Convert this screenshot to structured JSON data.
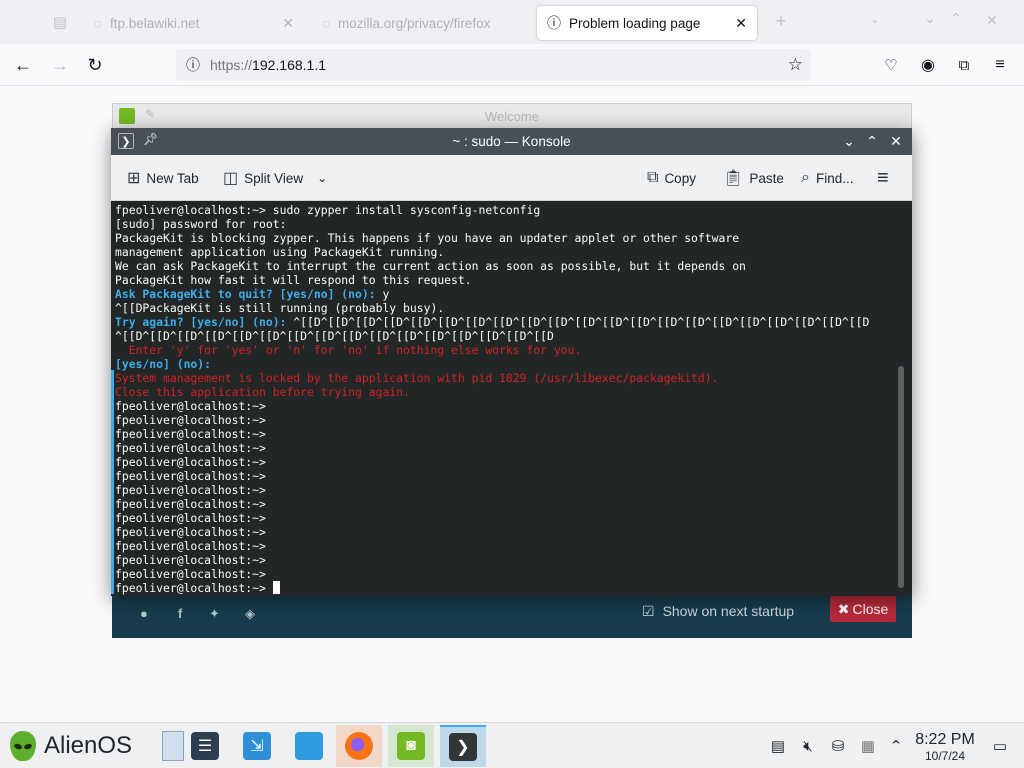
{
  "browser": {
    "tabs": [
      {
        "label": "ftp.belawiki.net"
      },
      {
        "label": "mozilla.org/privacy/firefox"
      },
      {
        "label": "Problem loading page"
      }
    ],
    "new_tab_symbol": "+",
    "url_proto": "https://",
    "url_host": "192.168.1.1"
  },
  "welcome": {
    "title": "Welcome",
    "show_startup_label": "Show on next startup",
    "close_label": "Close"
  },
  "konsole": {
    "title": "~ : sudo — Konsole",
    "toolbar": {
      "new_tab": "New Tab",
      "split_view": "Split View",
      "copy": "Copy",
      "paste": "Paste",
      "find": "Find..."
    },
    "lines": [
      {
        "text": "fpeoliver@localhost:~> sudo zypper install sysconfig-netconfig",
        "style": ""
      },
      {
        "text": "[sudo] password for root:",
        "style": ""
      },
      {
        "text": "PackageKit is blocking zypper. This happens if you have an updater applet or other software",
        "style": ""
      },
      {
        "text": "management application using PackageKit running.",
        "style": ""
      },
      {
        "text": "We can ask PackageKit to interrupt the current action as soon as possible, but it depends on",
        "style": ""
      },
      {
        "text": "PackageKit how fast it will respond to this request.",
        "style": ""
      },
      {
        "prefix": "Ask PackageKit to quit? [yes/no] (no): ",
        "rest": "y",
        "style": "mixed"
      },
      {
        "text": "^[[DPackageKit is still running (probably busy).",
        "style": ""
      },
      {
        "prefix": "Try again? [yes/no] (no): ",
        "rest": "^[[D^[[D^[[D^[[D^[[D^[[D^[[D^[[D^[[D^[[D^[[D^[[D^[[D^[[D^[[D^[[D^[[D^[[D^[[D^[[D^[[D",
        "style": "mixed"
      },
      {
        "text": "^[[D^[[D^[[D^[[D^[[D^[[D^[[D^[[D^[[D^[[D^[[D^[[D^[[D^[[D^[[D^[[D",
        "style": ""
      },
      {
        "text": "  Enter 'y' for 'yes' or 'n' for 'no' if nothing else works for you.",
        "style": "red"
      },
      {
        "text": "[yes/no] (no):",
        "style": "blue"
      },
      {
        "text": "System management is locked by the application with pid 1829 (/usr/libexec/packagekitd).",
        "style": "red"
      },
      {
        "text": "Close this application before trying again.",
        "style": "red"
      },
      {
        "text": "fpeoliver@localhost:~>",
        "style": ""
      },
      {
        "text": "fpeoliver@localhost:~>",
        "style": ""
      },
      {
        "text": "fpeoliver@localhost:~>",
        "style": ""
      },
      {
        "text": "fpeoliver@localhost:~>",
        "style": ""
      },
      {
        "text": "fpeoliver@localhost:~>",
        "style": ""
      },
      {
        "text": "fpeoliver@localhost:~>",
        "style": ""
      },
      {
        "text": "fpeoliver@localhost:~>",
        "style": ""
      },
      {
        "text": "fpeoliver@localhost:~>",
        "style": ""
      },
      {
        "text": "fpeoliver@localhost:~>",
        "style": ""
      },
      {
        "text": "fpeoliver@localhost:~>",
        "style": ""
      },
      {
        "text": "fpeoliver@localhost:~>",
        "style": ""
      },
      {
        "text": "fpeoliver@localhost:~>",
        "style": ""
      },
      {
        "text": "fpeoliver@localhost:~>",
        "style": ""
      }
    ],
    "prompt": "fpeoliver@localhost:~> "
  },
  "taskbar": {
    "launcher_label": "AlienOS",
    "time": "8:22 PM",
    "date": "10/7/24"
  },
  "colors": {
    "accent": "#3daee9",
    "terminal_bg": "#232627",
    "terminal_red": "#d02222",
    "welcome_bg": "#173c4d",
    "close_red": "#b72a3a"
  }
}
